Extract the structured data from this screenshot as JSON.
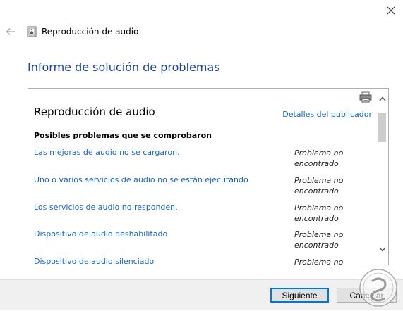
{
  "window": {
    "title": "Reproducción de audio"
  },
  "page": {
    "heading": "Informe de solución de problemas"
  },
  "report": {
    "title": "Reproducción de audio",
    "publisher_link": "Detalles del publicador",
    "section_label": "Posibles problemas que se comprobaron",
    "issues": [
      {
        "label": "Las mejoras de audio no se cargaron.",
        "status": "Problema no encontrado"
      },
      {
        "label": "Uno o varios servicios de audio no se están ejecutando",
        "status": "Problema no encontrado"
      },
      {
        "label": "Los servicios de audio no responden.",
        "status": "Problema no encontrado"
      },
      {
        "label": "Dispositivo de audio deshabilitado",
        "status": "Problema no encontrado"
      },
      {
        "label": "Dispositivo de audio silenciado",
        "status": "Problema no"
      }
    ]
  },
  "footer": {
    "next_label": "Siguiente",
    "cancel_label": "Cancelar"
  },
  "icons": {
    "close": "close-icon",
    "back": "back-arrow-icon",
    "app": "speaker-icon",
    "print": "printer-icon",
    "scroll_up": "chevron-up-icon",
    "scroll_down": "chevron-down-icon"
  },
  "colors": {
    "heading": "#1a3e9e",
    "link": "#1565c0",
    "focus_border": "#0078d7",
    "footer_bg": "#f0f0f0"
  }
}
